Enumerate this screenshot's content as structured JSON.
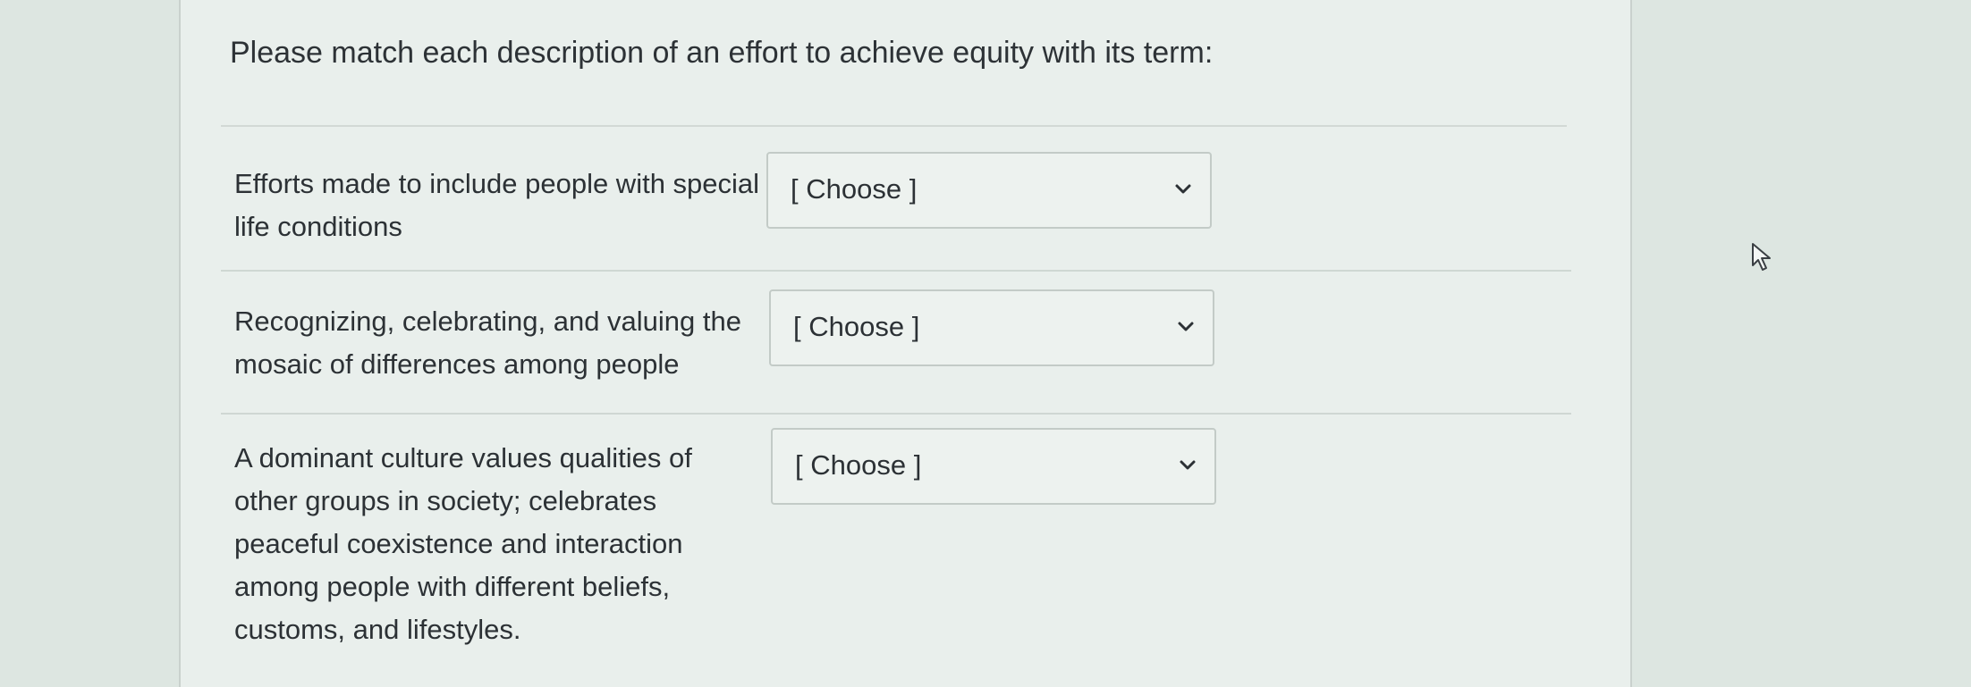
{
  "question": {
    "prompt": "Please match each description of an effort to achieve equity with its term:"
  },
  "rows": [
    {
      "description": "Efforts made to include people with special life conditions",
      "selected": "[ Choose ]"
    },
    {
      "description": "Recognizing, celebrating, and valuing the mosaic of differences among people",
      "selected": "[ Choose ]"
    },
    {
      "description": "A dominant culture values qualities of other groups in society; celebrates peaceful coexistence and interaction among people with different beliefs, customs, and lifestyles.",
      "selected": "[ Choose ]"
    }
  ],
  "icons": {
    "dropdown": "chevron-down-icon",
    "pointer": "mouse-cursor-icon"
  },
  "colors": {
    "panel_background": "#e9efec",
    "page_background": "#dde6e1",
    "text": "#2c3135",
    "border": "#c3cbc7"
  }
}
